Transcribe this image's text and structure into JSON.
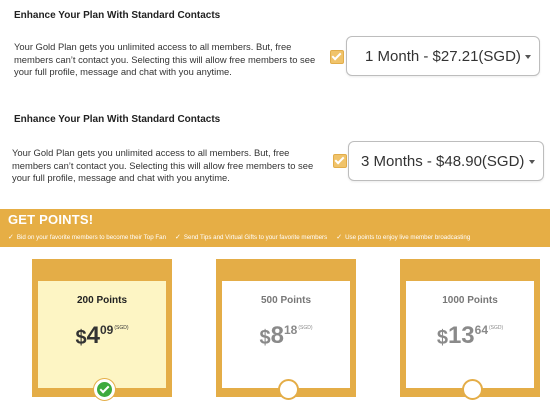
{
  "plans": [
    {
      "heading": "Enhance Your Plan With Standard Contacts",
      "description": "Your Gold Plan gets you unlimited access to all members. But, free members can’t contact you. Selecting this will allow free members to see your full profile, message and chat with you anytime.",
      "checked": true,
      "selected_option": "1 Month - $27.21(SGD)"
    },
    {
      "heading": "Enhance Your Plan With Standard Contacts",
      "description": "Your Gold Plan gets you unlimited access to all members. But, free members can’t contact you. Selecting this will allow free members to see your full profile, message and chat with you anytime.",
      "checked": true,
      "selected_option": "3 Months - $48.90(SGD)"
    }
  ],
  "points": {
    "title": "GET POINTS!",
    "bullets": [
      "Bid on your favorite members to become their Top Fan",
      "Send Tips and Virtual Gifts to your favorite members",
      "Use points to enjoy live member broadcasting"
    ],
    "packages": [
      {
        "label": "200 Points",
        "currency": "$",
        "whole": "4",
        "cents": "09",
        "unit": "(SGD)",
        "selected": true
      },
      {
        "label": "500 Points",
        "currency": "$",
        "whole": "8",
        "cents": "18",
        "unit": "(SGD)",
        "selected": false
      },
      {
        "label": "1000 Points",
        "currency": "$",
        "whole": "13",
        "cents": "64",
        "unit": "(SGD)",
        "selected": false
      }
    ]
  },
  "colors": {
    "accent": "#e6ae45",
    "selected_card_bg": "#fdf5c4",
    "selected_radio": "#3daa3d"
  },
  "icons": {
    "checkbox": "checkmark-icon",
    "bullet": "check-icon",
    "select": "chevron-down-icon",
    "radio_selected": "check-circle-icon"
  }
}
